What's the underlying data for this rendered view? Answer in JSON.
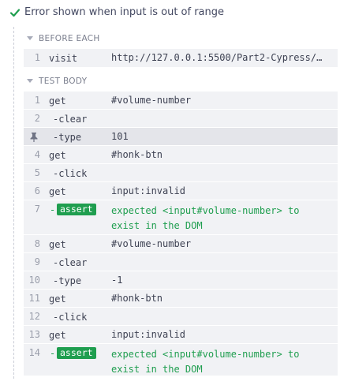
{
  "test": {
    "title": "Error shown when input is out of range",
    "status_icon": "check-icon",
    "status_color": "#1f9e4f"
  },
  "before_each": {
    "label": "BEFORE EACH",
    "rows": [
      {
        "num": "1",
        "cmd": "visit",
        "msg": "http://127.0.0.1:5500/Part2-Cypress/…"
      }
    ]
  },
  "test_body": {
    "label": "TEST BODY",
    "rows": [
      {
        "num": "1",
        "cmd": "get",
        "msg": "#volume-number"
      },
      {
        "num": "2",
        "cmd": "-clear",
        "msg": ""
      },
      {
        "num": "",
        "cmd": "-type",
        "msg": "101",
        "pinned": true,
        "icon": "pin-icon"
      },
      {
        "num": "4",
        "cmd": "get",
        "msg": "#honk-btn"
      },
      {
        "num": "5",
        "cmd": "-click",
        "msg": ""
      },
      {
        "num": "6",
        "cmd": "get",
        "msg": "input:invalid"
      },
      {
        "num": "7",
        "cmd": "-",
        "badge": "assert",
        "msg": "expected <input#volume-number> to exist in the DOM"
      },
      {
        "num": "8",
        "cmd": "get",
        "msg": "#volume-number"
      },
      {
        "num": "9",
        "cmd": "-clear",
        "msg": ""
      },
      {
        "num": "10",
        "cmd": "-type",
        "msg": "-1"
      },
      {
        "num": "11",
        "cmd": "get",
        "msg": "#honk-btn"
      },
      {
        "num": "12",
        "cmd": "-click",
        "msg": ""
      },
      {
        "num": "13",
        "cmd": "get",
        "msg": "input:invalid"
      },
      {
        "num": "14",
        "cmd": "-",
        "badge": "assert",
        "msg": "expected <input#volume-number> to exist in the DOM"
      }
    ]
  },
  "colors": {
    "pass": "#1f9e4f",
    "row_bg": "#f1f2f5",
    "pinned_bg": "#e4e5ea"
  }
}
